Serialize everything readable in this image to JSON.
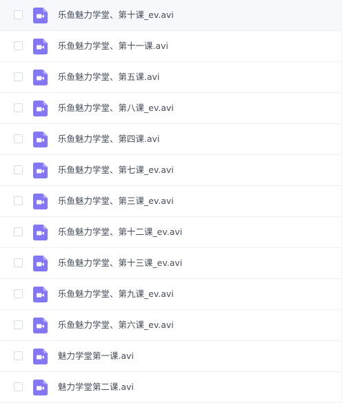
{
  "file_list": {
    "icon": "video-file-icon",
    "icon_color": "#8377f4",
    "files": [
      {
        "name": "乐鱼魅力学堂、第十课_ev.avi"
      },
      {
        "name": "乐鱼魅力学堂、第十一课.avi"
      },
      {
        "name": "乐鱼魅力学堂、第五课.avi"
      },
      {
        "name": "乐鱼魅力学堂、第八课_ev.avi"
      },
      {
        "name": "乐鱼魅力学堂、第四课.avi"
      },
      {
        "name": "乐鱼魅力学堂、第七课_ev.avi"
      },
      {
        "name": "乐鱼魅力学堂、第三课_ev.avi"
      },
      {
        "name": "乐鱼魅力学堂、第十二课_ev.avi"
      },
      {
        "name": "乐鱼魅力学堂、第十三课_ev.avi"
      },
      {
        "name": "乐鱼魅力学堂、第九课_ev.avi"
      },
      {
        "name": "乐鱼魅力学堂、第六课_ev.avi"
      },
      {
        "name": "魅力学堂第一课.avi"
      },
      {
        "name": "魅力学堂第二课.avi"
      }
    ]
  }
}
